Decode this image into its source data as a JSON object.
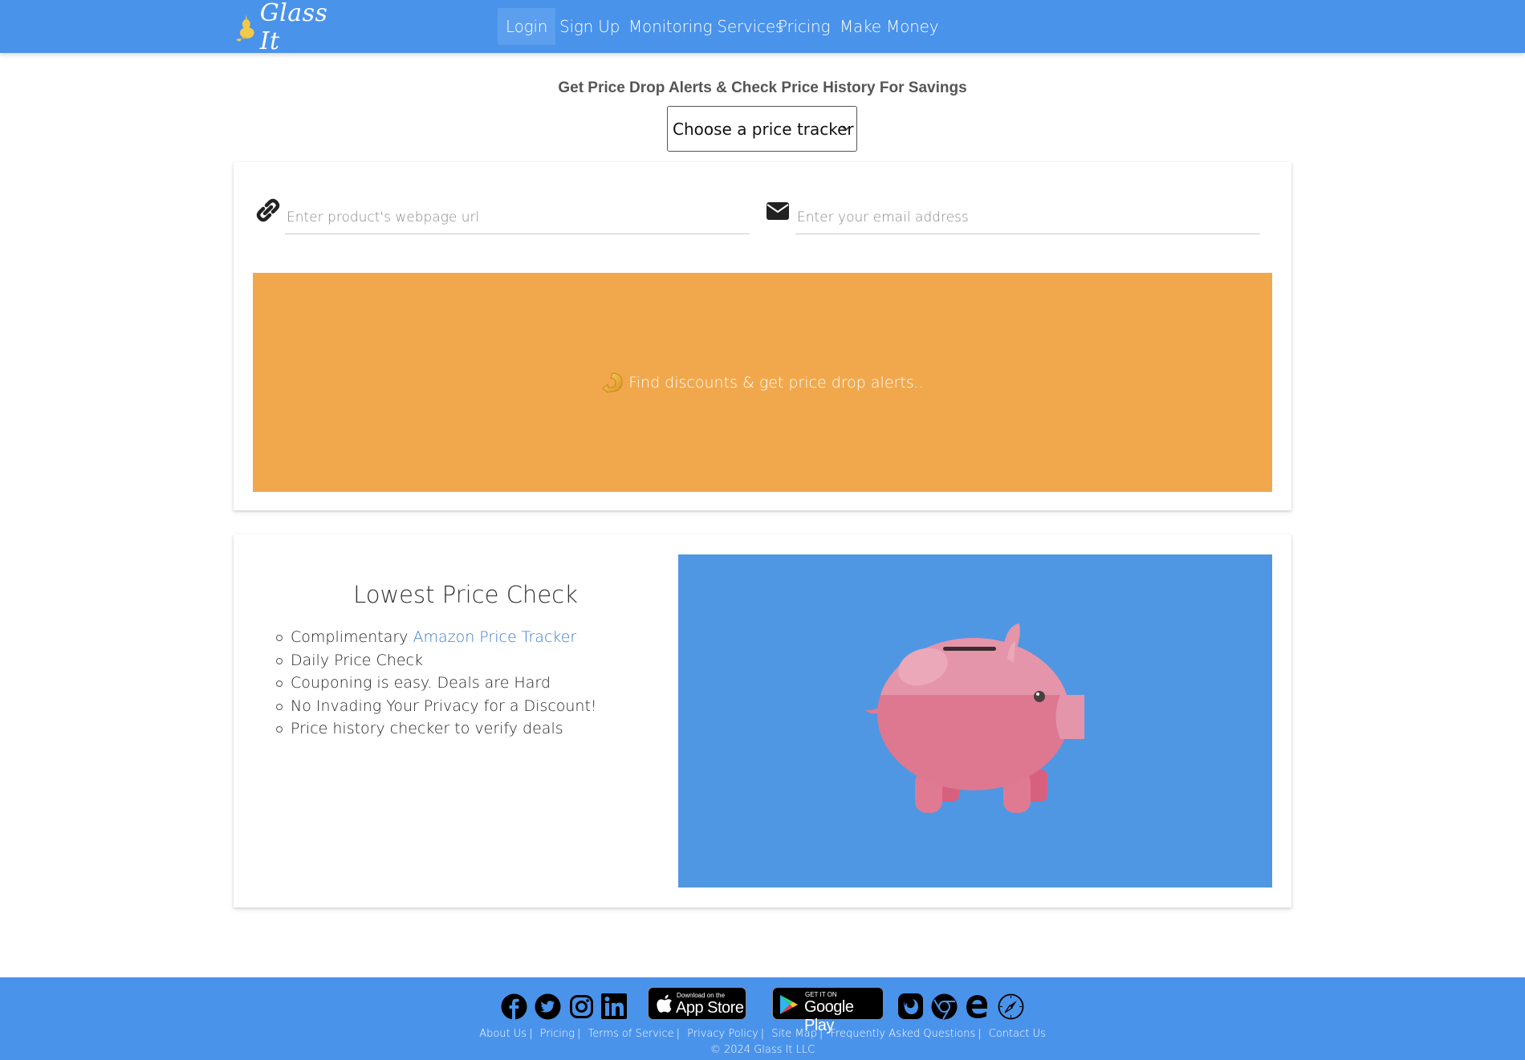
{
  "header": {
    "brand": "Glass It",
    "nav": [
      {
        "label": "Login",
        "active": true
      },
      {
        "label": "Sign Up"
      },
      {
        "label": "Monitoring Services"
      },
      {
        "label": "Pricing"
      },
      {
        "label": "Make Money"
      }
    ],
    "bg_color": "#4A93EB"
  },
  "intro": {
    "heading": "Get Price Drop Alerts & Check Price History For Savings",
    "tracker_select": {
      "selected": "Choose a price tracker"
    }
  },
  "tracker_form": {
    "url_input": {
      "value": "",
      "placeholder": "Enter product's webpage url",
      "icon": "link-icon"
    },
    "email_input": {
      "value": "",
      "placeholder": "Enter your email address",
      "icon": "envelope-icon"
    },
    "submit": {
      "label": "Find discounts & get price drop alerts..",
      "icon": "curved-arrow-icon",
      "color": "#F1A84C"
    }
  },
  "feature_card": {
    "heading": "Lowest Price Check",
    "items": [
      {
        "text": "Complimentary ",
        "link": "Amazon Price Tracker"
      },
      {
        "text": "Daily Price Check"
      },
      {
        "text": "Couponing is easy. Deals are Hard"
      },
      {
        "text": "No Invading Your Privacy for a Discount!"
      },
      {
        "text": "Price history checker to verify deals"
      }
    ],
    "image": "piggy-bank-illustration",
    "image_bg": "#4F97E3"
  },
  "footer": {
    "social_icons": [
      "facebook-icon",
      "twitter-icon",
      "instagram-icon",
      "linkedin-icon"
    ],
    "app_store": {
      "small": "Download on the",
      "big": "App Store"
    },
    "google_play": {
      "small": "GET IT ON",
      "big": "Google Play"
    },
    "browser_icons": [
      "firefox-icon",
      "chrome-icon",
      "edge-icon",
      "safari-icon"
    ],
    "links": [
      "About Us",
      "Pricing",
      "Terms of Service",
      "Privacy Policy",
      "Site Map",
      "Frequently Asked Questions",
      "Contact Us"
    ],
    "copyright": "© 2024 Glass It LLC"
  }
}
